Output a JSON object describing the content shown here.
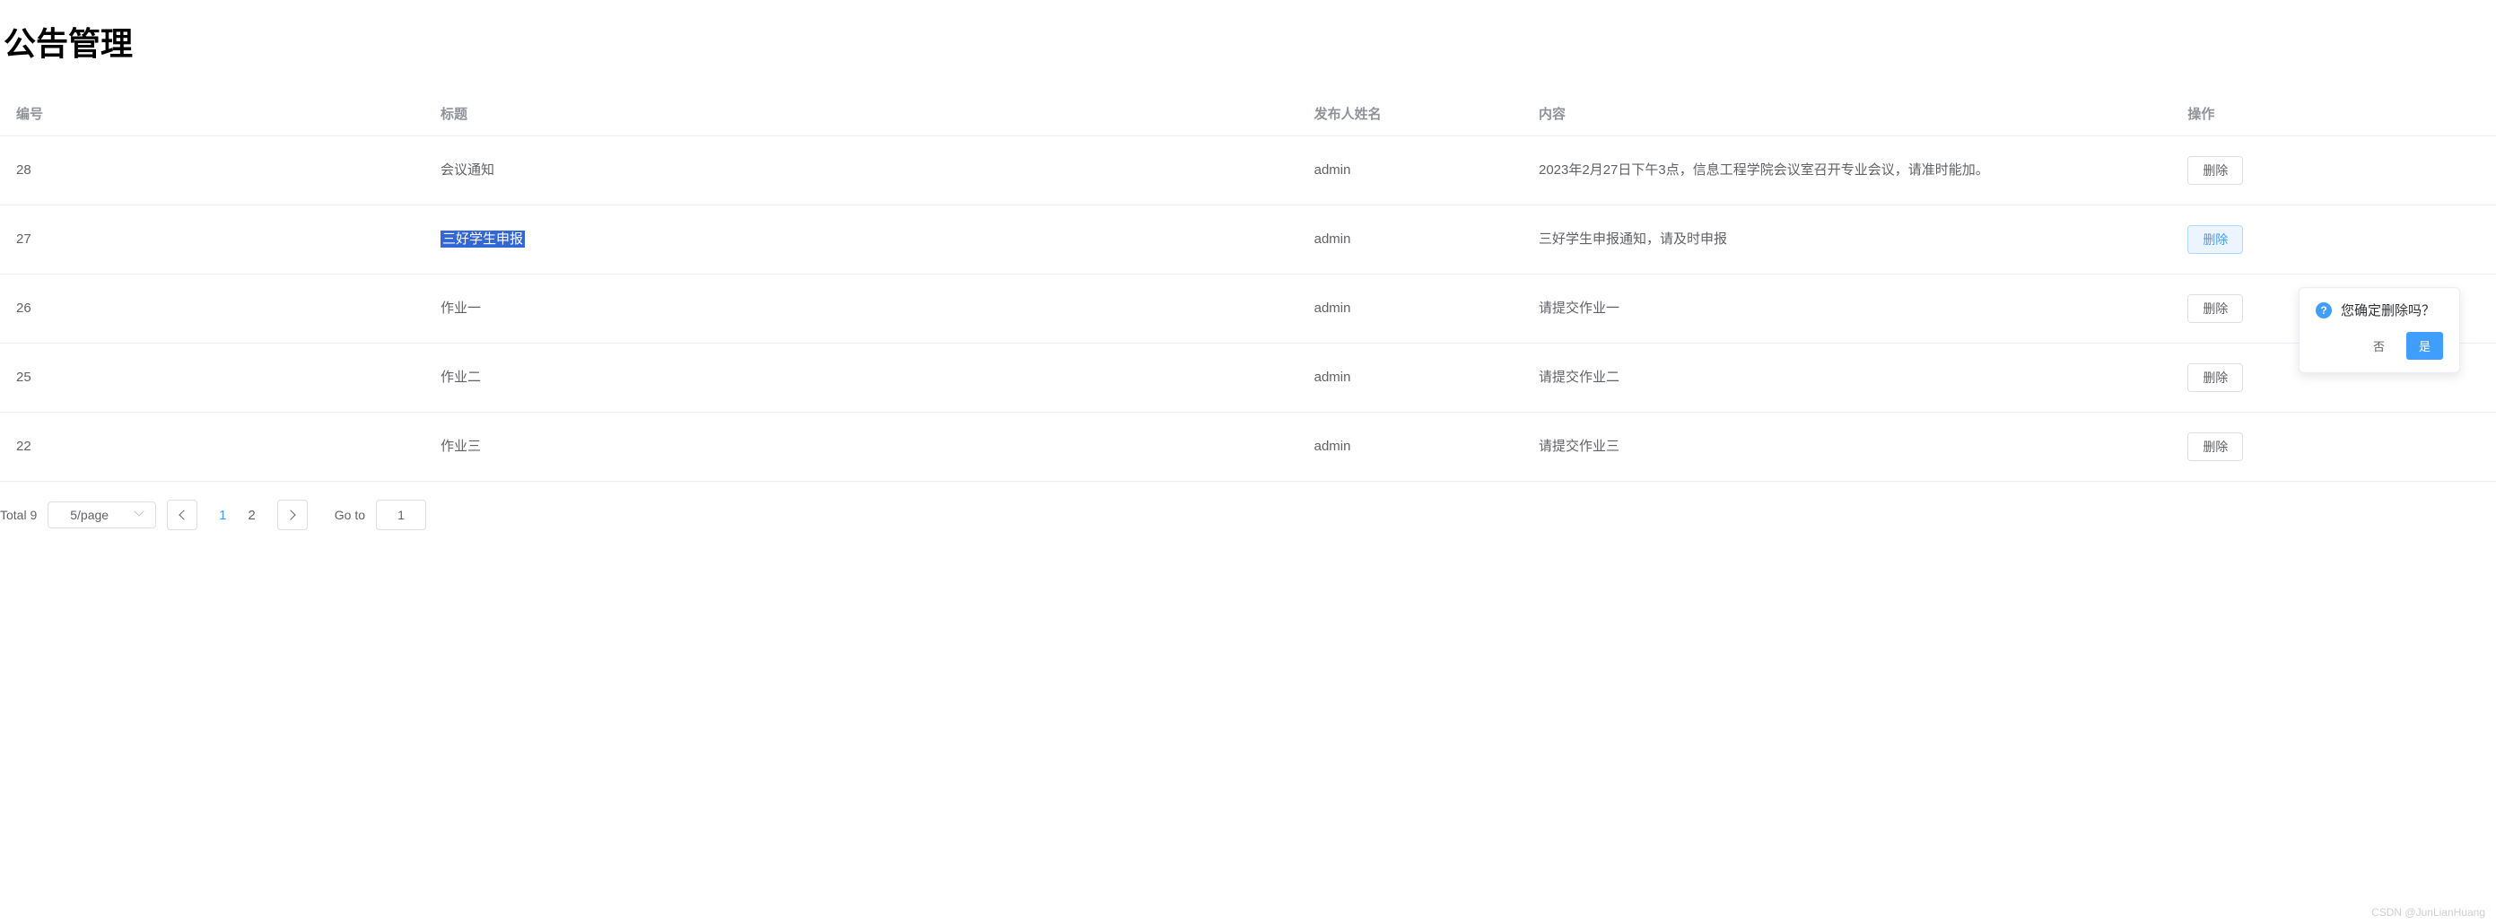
{
  "page_title": "公告管理",
  "table": {
    "columns": {
      "id": "编号",
      "title": "标题",
      "publisher": "发布人姓名",
      "content": "内容",
      "action": "操作"
    },
    "rows": [
      {
        "id": "28",
        "title": "会议通知",
        "publisher": "admin",
        "content": "2023年2月27日下午3点，信息工程学院会议室召开专业会议，请准时能加。",
        "highlighted": false,
        "action_active": false
      },
      {
        "id": "27",
        "title": "三好学生申报",
        "publisher": "admin",
        "content": "三好学生申报通知，请及时申报",
        "highlighted": true,
        "action_active": true
      },
      {
        "id": "26",
        "title": "作业一",
        "publisher": "admin",
        "content": "请提交作业一",
        "highlighted": false,
        "action_active": false
      },
      {
        "id": "25",
        "title": "作业二",
        "publisher": "admin",
        "content": "请提交作业二",
        "highlighted": false,
        "action_active": false
      },
      {
        "id": "22",
        "title": "作业三",
        "publisher": "admin",
        "content": "请提交作业三",
        "highlighted": false,
        "action_active": false
      }
    ],
    "delete_label": "删除"
  },
  "pagination": {
    "total_label": "Total 9",
    "page_size_label": "5/page",
    "pages": [
      "1",
      "2"
    ],
    "current_page": "1",
    "goto_label": "Go to",
    "goto_value": "1"
  },
  "popconfirm": {
    "message": "您确定删除吗？",
    "no_label": "否",
    "yes_label": "是"
  },
  "watermark": "CSDN @JunLianHuang"
}
